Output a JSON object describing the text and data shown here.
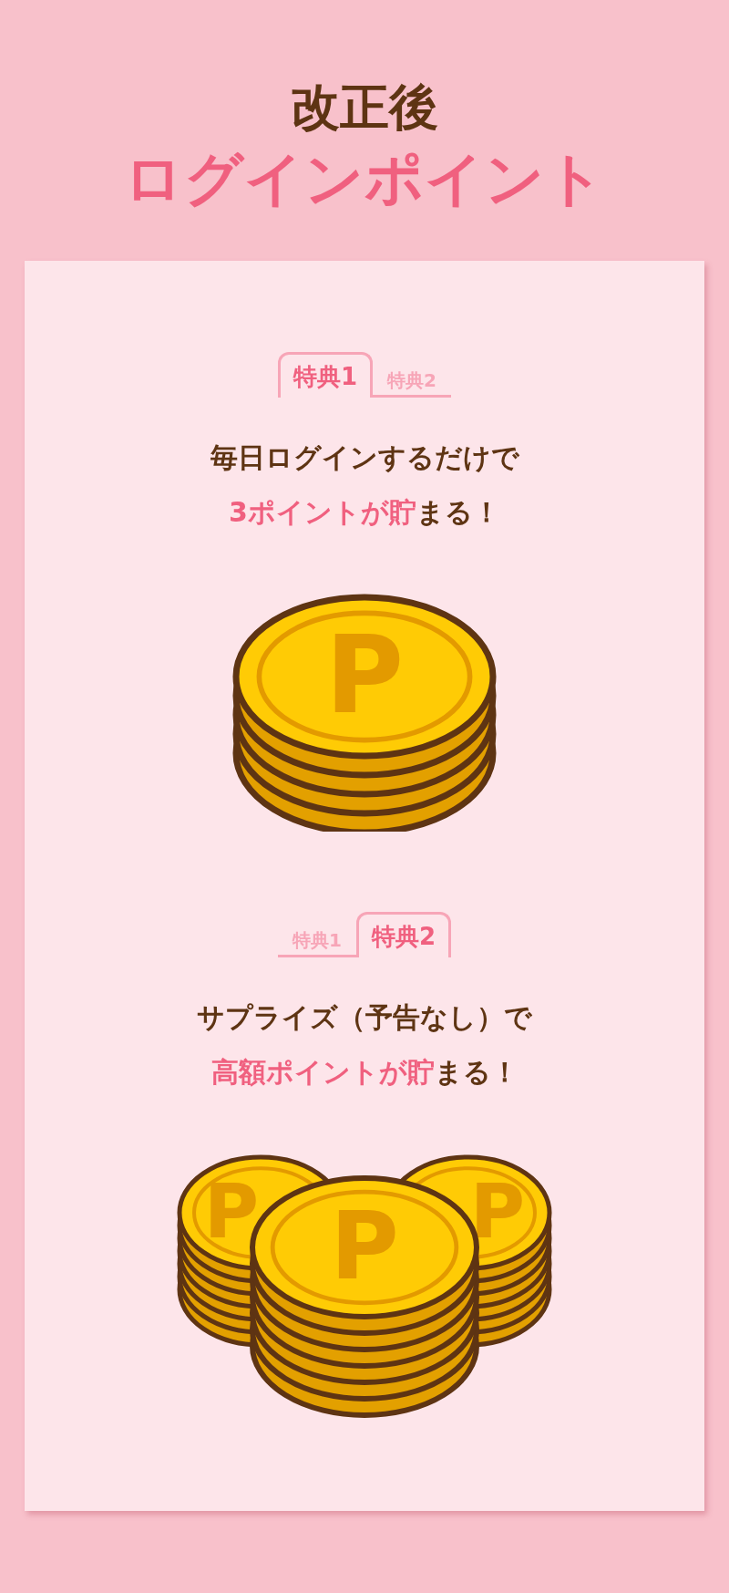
{
  "header": {
    "title": "改正後",
    "subtitle": "ログインポイント"
  },
  "sections": [
    {
      "tabs": [
        {
          "label": "特典1",
          "selected": true
        },
        {
          "label": "特典2",
          "selected": false
        }
      ],
      "lines": [
        "毎日ログインするだけで",
        "**3ポイントが貯**まる！"
      ],
      "coins": {
        "kind": "single",
        "marks": [
          "P"
        ]
      }
    },
    {
      "tabs": [
        {
          "label": "特典1",
          "selected": false
        },
        {
          "label": "特典2",
          "selected": true
        }
      ],
      "lines": [
        "サプライズ（予告なし）で",
        "**高額ポイントが貯**まる！"
      ],
      "coins": {
        "kind": "triple",
        "marks": [
          "P",
          "P",
          "P"
        ]
      }
    }
  ]
}
